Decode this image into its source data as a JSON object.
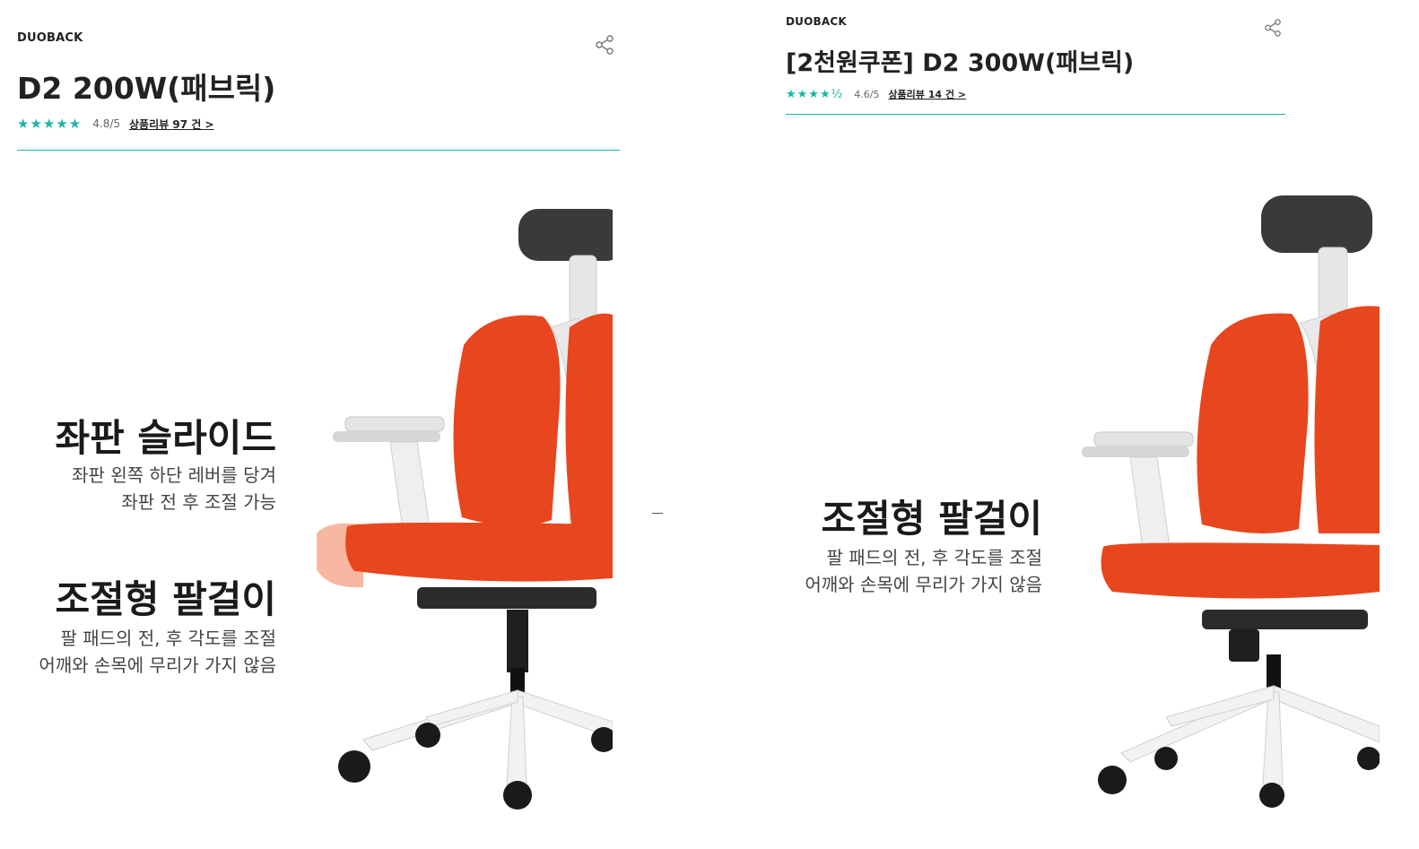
{
  "left": {
    "brand": "DUOBACK",
    "title": "D2 200W(패브릭)",
    "stars": "★★★★★",
    "score": "4.8/5",
    "review_link": "상품리뷰 97 건 >",
    "features": [
      {
        "title": "좌판 슬라이드",
        "lines": [
          "좌판 왼쪽 하단 레버를 당겨",
          "좌판 전 후 조절 가능"
        ]
      },
      {
        "title": "조절형 팔걸이",
        "lines": [
          "팔 패드의 전, 후 각도를 조절",
          "어깨와 손목에 무리가 가지 않음"
        ]
      }
    ]
  },
  "right": {
    "brand": "DUOBACK",
    "title": "[2천원쿠폰] D2 300W(패브릭)",
    "stars": "★★★★½",
    "score": "4.6/5",
    "review_link": "상품리뷰 14 건 >",
    "features": [
      {
        "title": "조절형 팔걸이",
        "lines": [
          "팔 패드의 전, 후 각도를 조절",
          "어깨와 손목에 무리가 가지 않음"
        ]
      }
    ]
  },
  "icons": {
    "share": "share-icon",
    "star": "star-icon"
  },
  "colors": {
    "accent": "#19b7a3",
    "seat_orange": "#e8461e",
    "headrest": "#3a3a3a",
    "frame": "#e9e9e9"
  }
}
